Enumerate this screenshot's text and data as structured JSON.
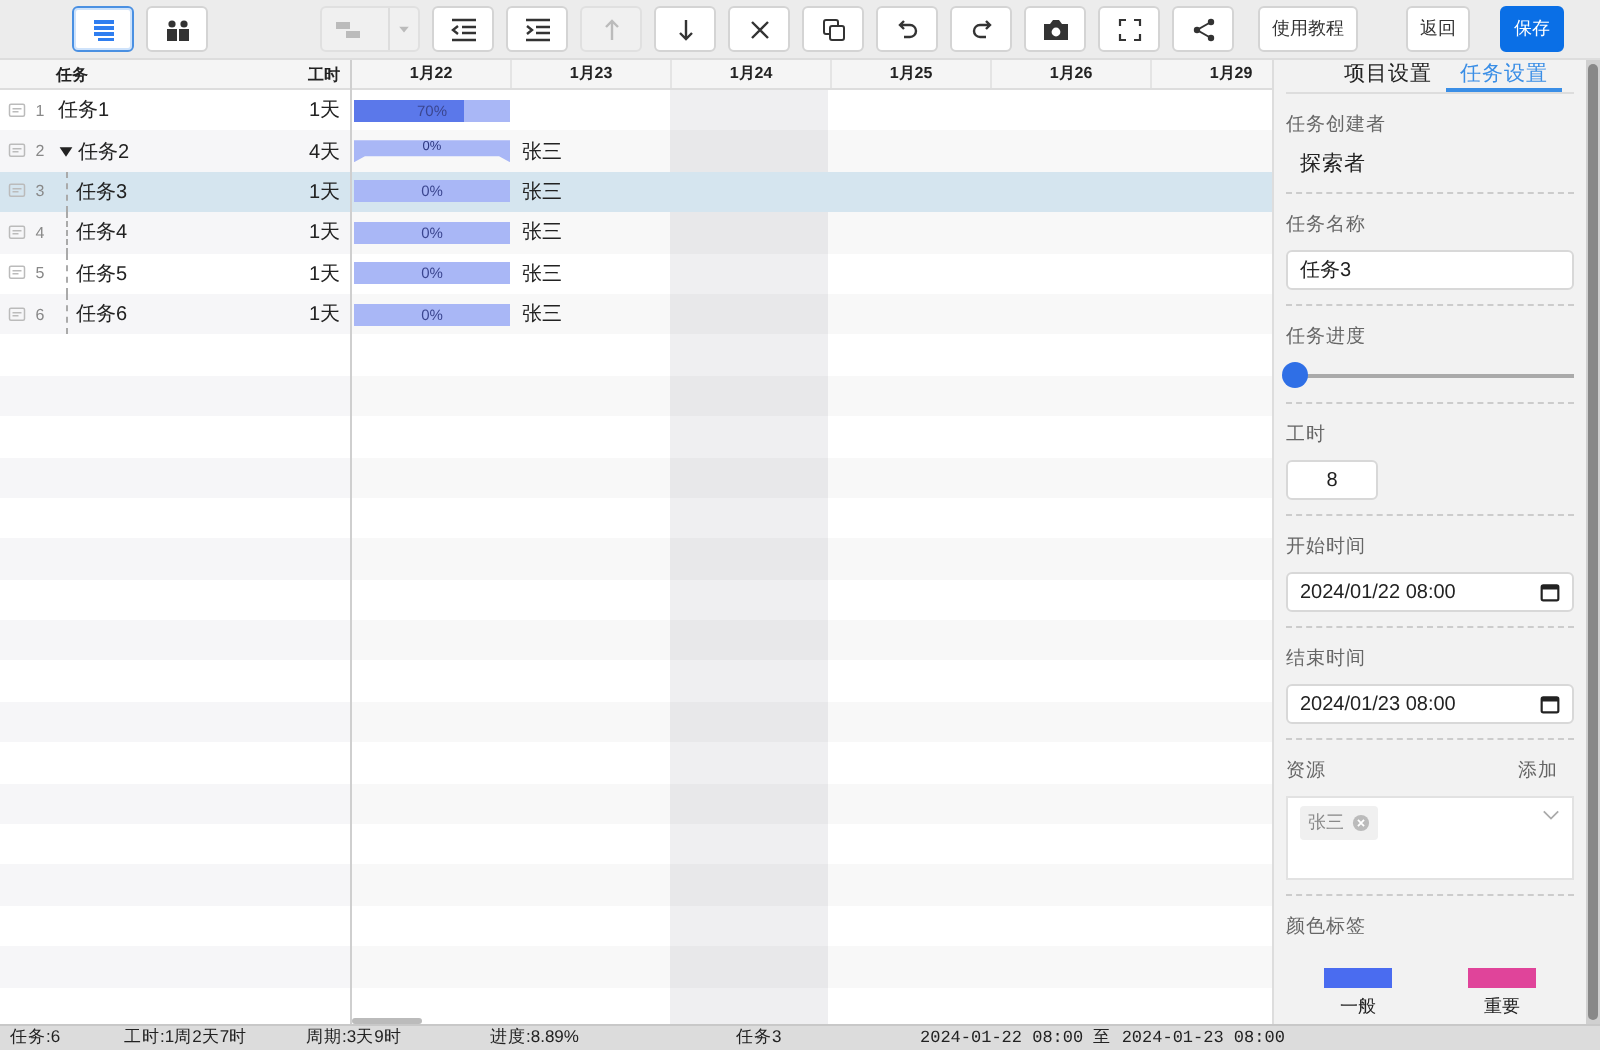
{
  "toolbar": {
    "view_buttons": [
      {
        "kind": "list",
        "selected": true
      },
      {
        "kind": "people",
        "selected": false
      }
    ],
    "tools": [
      {
        "kind": "link",
        "disabled": true
      },
      {
        "kind": "outdent",
        "disabled": false
      },
      {
        "kind": "indent",
        "disabled": false
      },
      {
        "kind": "up",
        "disabled": true
      },
      {
        "kind": "down",
        "disabled": false
      },
      {
        "kind": "close",
        "disabled": false
      },
      {
        "kind": "copy",
        "disabled": false
      },
      {
        "kind": "undo",
        "disabled": false
      },
      {
        "kind": "redo",
        "disabled": false
      },
      {
        "kind": "camera",
        "disabled": false
      },
      {
        "kind": "fullscreen",
        "disabled": false
      },
      {
        "kind": "share",
        "disabled": false
      }
    ],
    "text_buttons": [
      {
        "label": "使用教程",
        "kind": "default"
      },
      {
        "label": "返回",
        "kind": "default"
      },
      {
        "label": "保存",
        "kind": "primary"
      }
    ]
  },
  "table": {
    "columns": [
      "任务",
      "工时"
    ],
    "rows": [
      {
        "number": "1",
        "name": "任务1",
        "duration": "1天",
        "selected": false,
        "kind": "task",
        "bar": {
          "level": 0.7,
          "label": "70%"
        }
      },
      {
        "number": "2",
        "name": "任务2",
        "duration": "4天",
        "selected": false,
        "kind": "summary",
        "expanded": true,
        "bar": {
          "level": 0,
          "label": "0%"
        },
        "resource": "张三",
        "children": [
          {
            "number": "3",
            "name": "任务3",
            "duration": "1天",
            "selected": true,
            "kind": "task",
            "bar": {
              "level": 0,
              "label": "0%"
            },
            "resource": "张三"
          },
          {
            "number": "4",
            "name": "任务4",
            "duration": "1天",
            "selected": false,
            "kind": "task",
            "bar": {
              "level": 0,
              "label": "0%"
            },
            "resource": "张三"
          },
          {
            "number": "5",
            "name": "任务5",
            "duration": "1天",
            "selected": false,
            "kind": "task",
            "bar": {
              "level": 0,
              "label": "0%"
            },
            "resource": "张三"
          },
          {
            "number": "6",
            "name": "任务6",
            "duration": "1天",
            "selected": false,
            "kind": "task",
            "bar": {
              "level": 0,
              "label": "0%"
            },
            "resource": "张三"
          }
        ]
      }
    ]
  },
  "timeline": {
    "dates": [
      "1月22",
      "1月23",
      "1月24",
      "1月25",
      "1月26",
      "1月29"
    ]
  },
  "settings": {
    "tabs": [
      {
        "label": "项目设置",
        "selected": false
      },
      {
        "label": "任务设置",
        "selected": true
      }
    ],
    "fields": [
      {
        "kind": "text",
        "label": "任务创建者",
        "value": "探索者"
      },
      {
        "kind": "input",
        "label": "任务名称",
        "value": "任务3"
      },
      {
        "kind": "slider",
        "label": "任务进度",
        "level": 0
      },
      {
        "kind": "number",
        "label": "工时",
        "value": "8"
      },
      {
        "kind": "datetime",
        "label": "开始时间",
        "value": "2024/01/22 08:00"
      },
      {
        "kind": "datetime",
        "label": "结束时间",
        "value": "2024/01/23 08:00"
      },
      {
        "kind": "resources",
        "label": "资源",
        "action": "添加",
        "tags": [
          "张三"
        ]
      },
      {
        "kind": "colors",
        "label": "颜色标签",
        "swatches": [
          {
            "label": "一般",
            "color": "#4a6cf0"
          },
          {
            "label": "重要",
            "color": "#e0449a"
          }
        ]
      }
    ]
  },
  "status_bar": [
    "任务:6",
    "工时:1周2天7时",
    "周期:3天9时",
    "进度:8.89%",
    "任务3",
    "2024-01-22 08:00 至 2024-01-23 08:00"
  ]
}
